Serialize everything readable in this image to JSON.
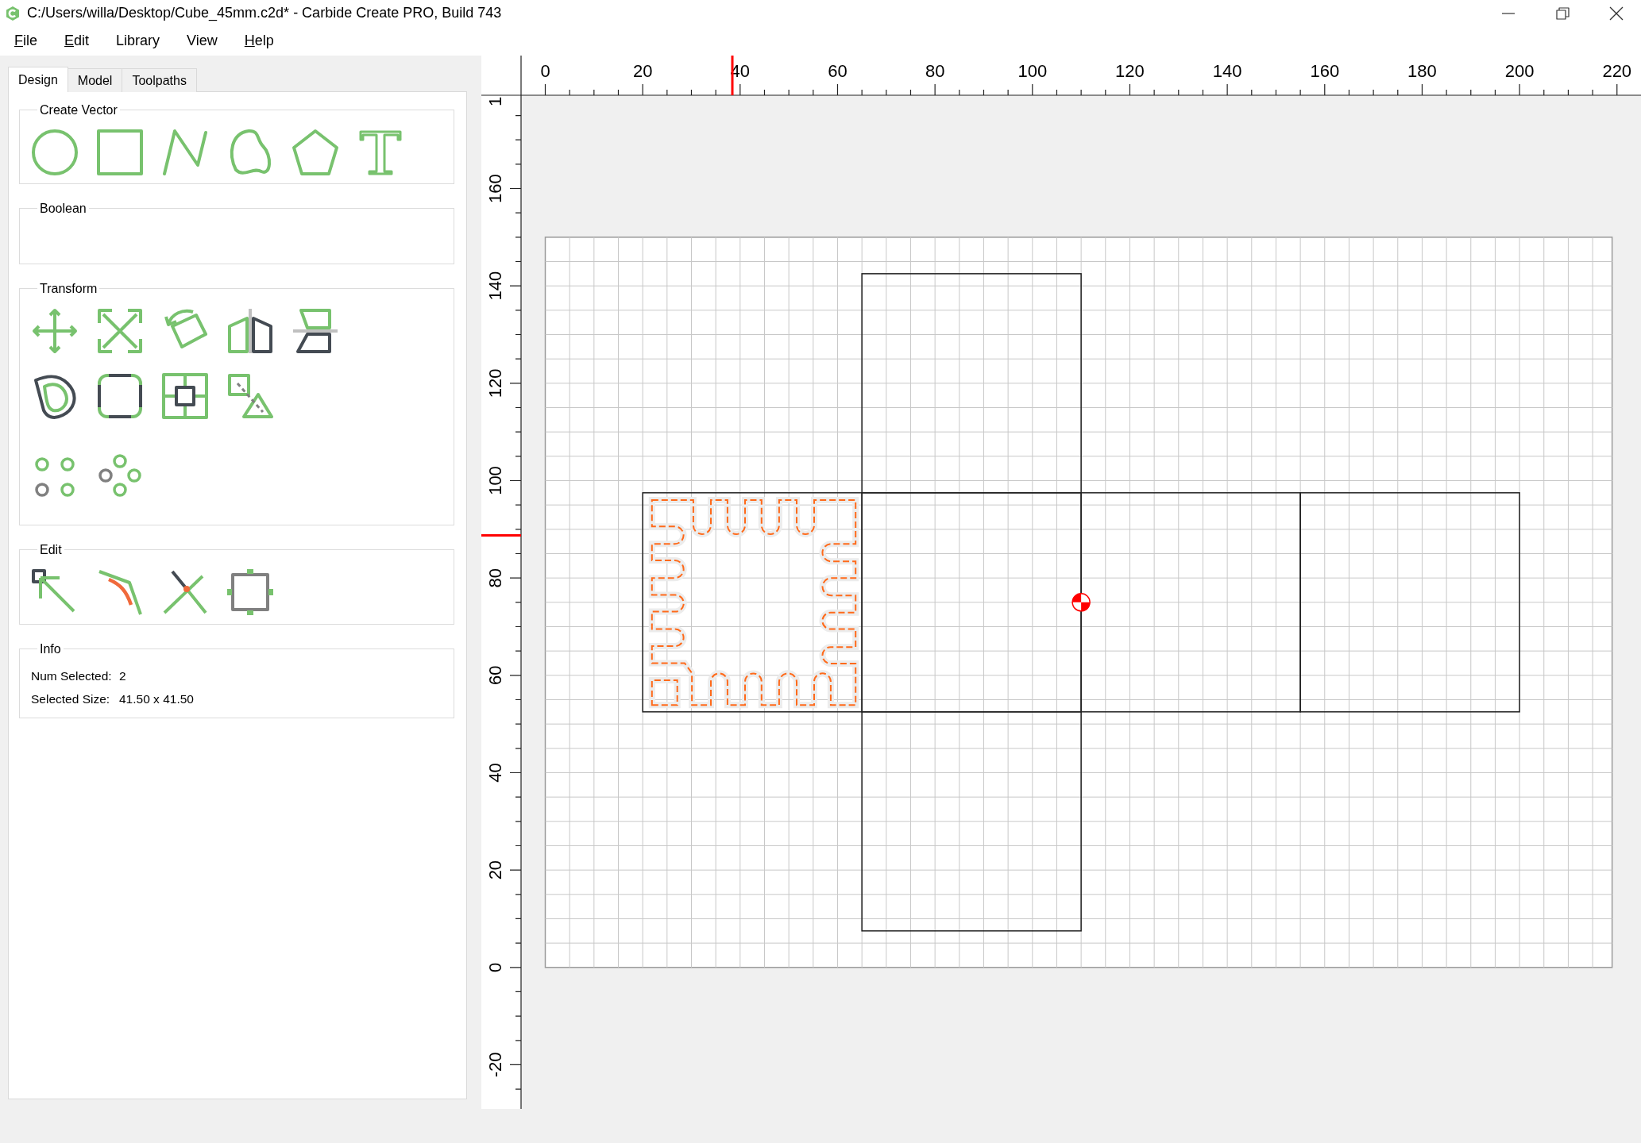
{
  "window": {
    "title": "C:/Users/willa/Desktop/Cube_45mm.c2d* - Carbide Create PRO, Build 743"
  },
  "menu": [
    {
      "label": "File",
      "underline_first": true
    },
    {
      "label": "Edit",
      "underline_first": true
    },
    {
      "label": "Library",
      "underline_first": false
    },
    {
      "label": "View",
      "underline_first": false
    },
    {
      "label": "Help",
      "underline_first": true
    }
  ],
  "tabs": [
    {
      "label": "Design",
      "selected": true
    },
    {
      "label": "Model",
      "selected": false
    },
    {
      "label": "Toolpaths",
      "selected": false
    }
  ],
  "panel": {
    "groups": [
      {
        "title": "Create Vector",
        "kind": "create_vector"
      },
      {
        "title": "Boolean",
        "kind": "boolean"
      },
      {
        "title": "Transform",
        "kind": "transform"
      },
      {
        "title": "Edit",
        "kind": "edit"
      },
      {
        "title": "Info",
        "kind": "info",
        "rows": [
          {
            "label": "Num Selected:",
            "value": "2"
          },
          {
            "label": "Selected Size:",
            "value": "41.50 x 41.50"
          }
        ]
      }
    ]
  },
  "canvas": {
    "top_ruler": {
      "labels": [
        "0",
        "20",
        "40",
        "60",
        "80",
        "100",
        "120",
        "140",
        "160",
        "180",
        "200",
        "220"
      ]
    },
    "left_ruler": {
      "labels": [
        "1",
        "160",
        "140",
        "120",
        "100",
        "80",
        "60",
        "40",
        "20",
        "0",
        "-20"
      ]
    }
  }
}
